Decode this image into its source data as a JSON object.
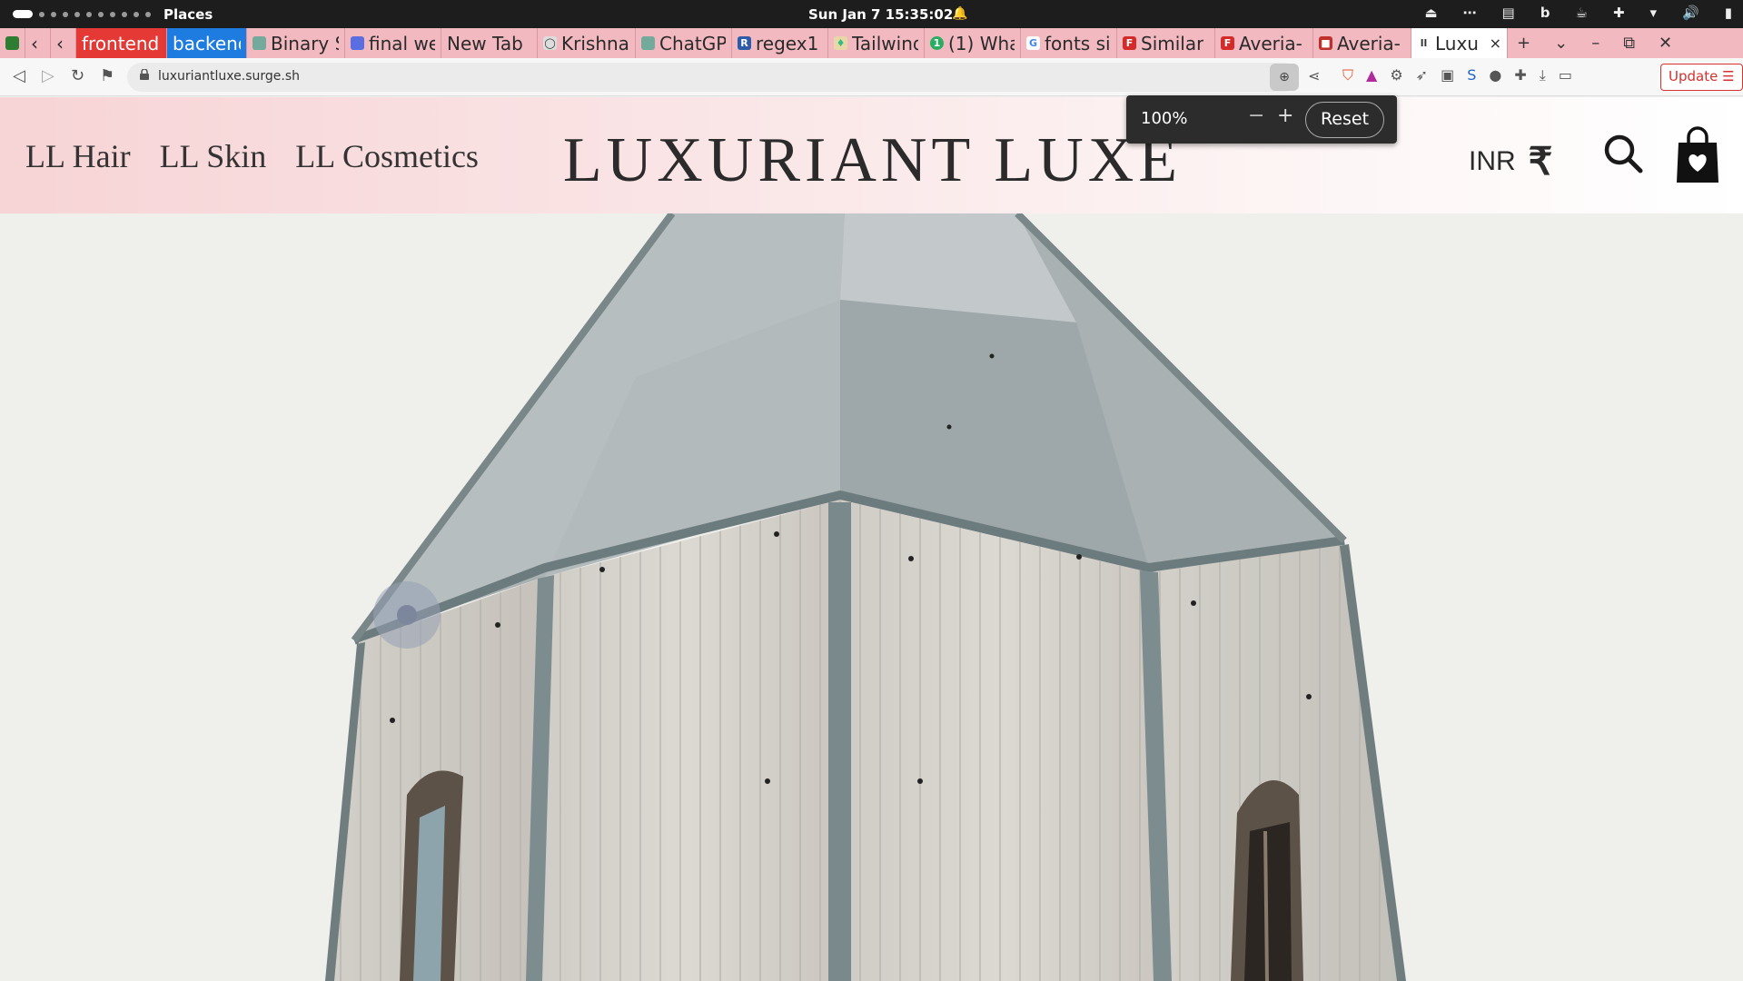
{
  "os": {
    "places_label": "Places",
    "clock": "Sun Jan 7  15:35:02",
    "tray_icons": [
      "eject-icon",
      "more-icon",
      "clipboard-icon",
      "bing-icon",
      "coffee-icon",
      "puzzle-icon",
      "wifi-icon",
      "volume-icon",
      "battery-icon"
    ]
  },
  "tabs": [
    {
      "label": "frontend",
      "style": "red",
      "icon": ""
    },
    {
      "label": "backend",
      "style": "blue",
      "icon": ""
    },
    {
      "label": "Binary S",
      "style": "",
      "icon": "openai-icon"
    },
    {
      "label": "final we",
      "style": "",
      "icon": "calendar-icon"
    },
    {
      "label": "New Tab",
      "style": "",
      "icon": ""
    },
    {
      "label": "Krishna",
      "style": "",
      "icon": "github-icon"
    },
    {
      "label": "ChatGP",
      "style": "",
      "icon": "openai-icon"
    },
    {
      "label": "regex1",
      "style": "",
      "icon": "regex-icon"
    },
    {
      "label": "Tailwind",
      "style": "",
      "icon": "tailwind-icon"
    },
    {
      "label": "(1) Wha",
      "style": "",
      "icon": "whatsapp-icon"
    },
    {
      "label": "fonts si",
      "style": "",
      "icon": "google-icon"
    },
    {
      "label": "Similar",
      "style": "",
      "icon": "font-icon"
    },
    {
      "label": "Averia-",
      "style": "",
      "icon": "font-icon"
    },
    {
      "label": "Averia-",
      "style": "",
      "icon": "font-icon"
    },
    {
      "label": "Luxur",
      "style": "active",
      "icon": "site-icon"
    }
  ],
  "address": {
    "url": "luxuriantluxe.surge.sh",
    "update_label": "Update"
  },
  "zoom": {
    "value": "100%",
    "minus": "−",
    "plus": "+",
    "reset_label": "Reset"
  },
  "site": {
    "nav": [
      "LL Hair",
      "LL Skin",
      "LL Cosmetics"
    ],
    "brand": "LUXURIANT LUXE",
    "currency": "INR",
    "currency_symbol": "₹"
  },
  "colors": {
    "tab_strip": "#f2b9c1",
    "frontend_tab": "#e53935",
    "backend_tab": "#1e7be0",
    "update_red": "#d4312f"
  }
}
